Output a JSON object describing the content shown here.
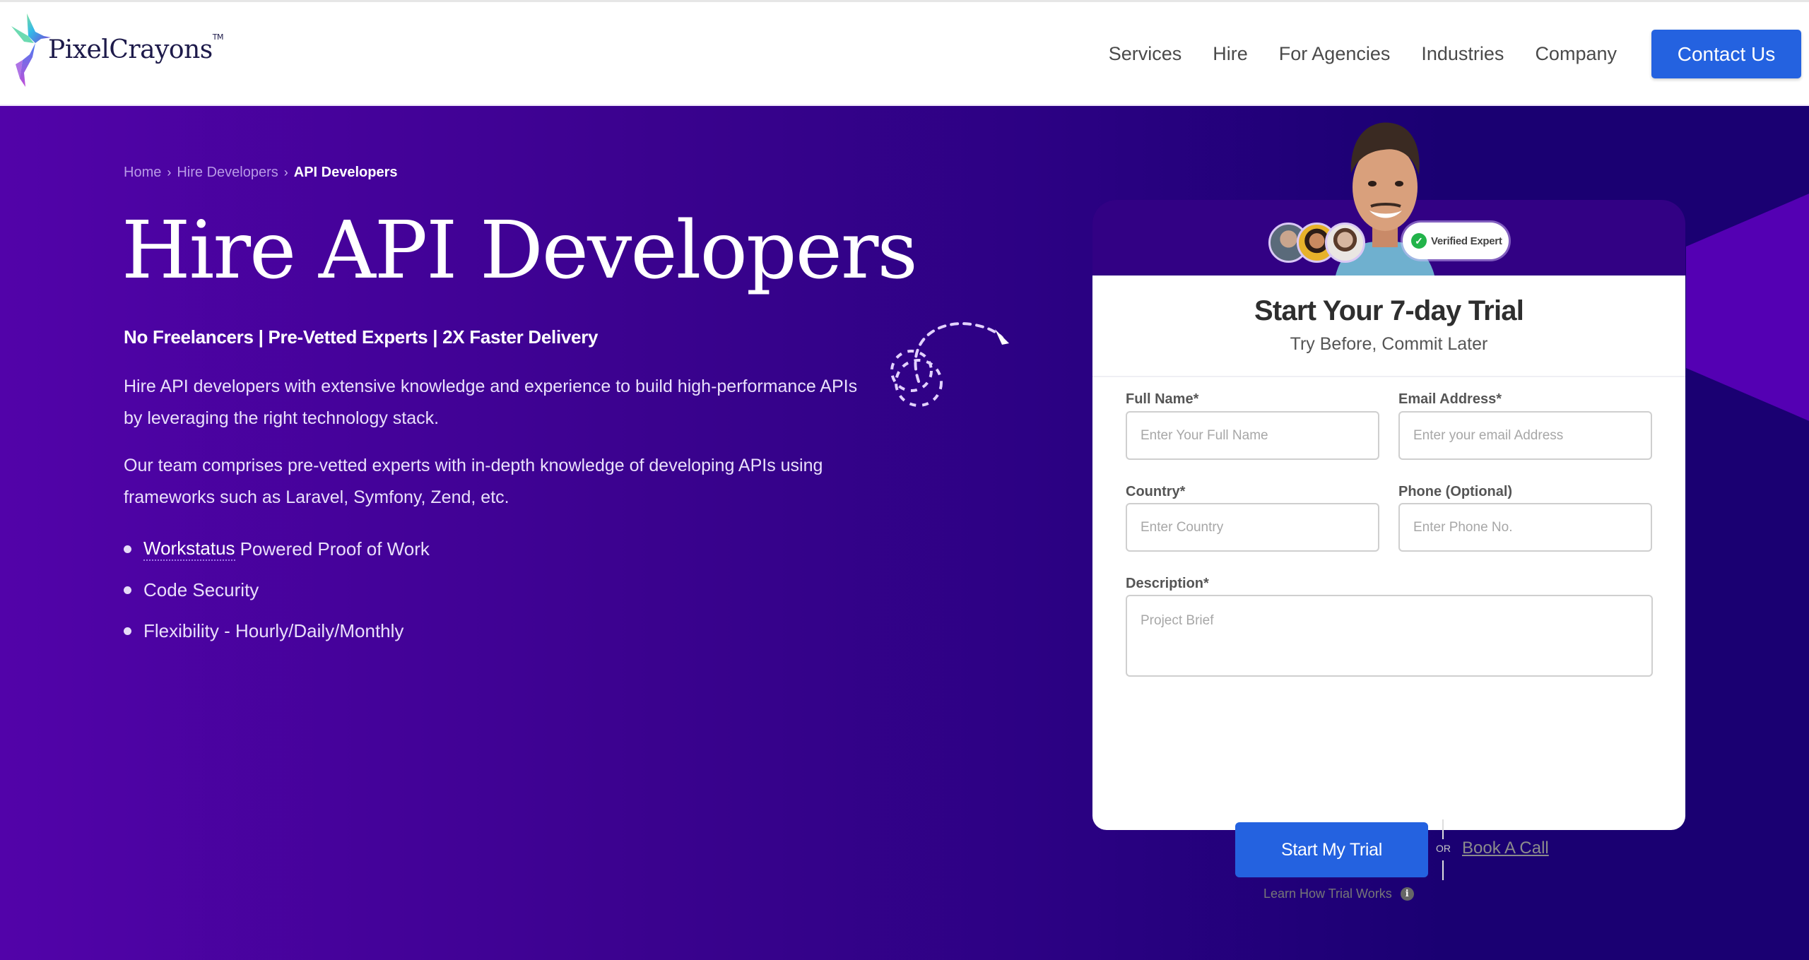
{
  "header": {
    "logo_text": "PixelCrayons",
    "logo_tm": "TM",
    "nav": [
      {
        "label": "Services"
      },
      {
        "label": "Hire"
      },
      {
        "label": "For Agencies"
      },
      {
        "label": "Industries"
      },
      {
        "label": "Company"
      }
    ],
    "contact_label": "Contact Us"
  },
  "hero": {
    "breadcrumb": [
      {
        "label": "Home"
      },
      {
        "label": "Hire Developers"
      },
      {
        "label": "API Developers"
      }
    ],
    "breadcrumb_separator": "›",
    "title": "Hire API Developers",
    "tagline": "No Freelancers | Pre-Vetted Experts | 2X Faster Delivery",
    "paragraph_1": "Hire API developers with extensive knowledge and experience to build high-performance APIs by leveraging the right technology stack.",
    "paragraph_2": "Our team comprises pre-vetted experts with in-depth knowledge of developing APIs using frameworks such as Laravel, Symfony, Zend, etc.",
    "bullets": [
      {
        "link": "Workstatus",
        "text": "Powered Proof of Work"
      },
      {
        "text": "Code Security"
      },
      {
        "text": "Flexibility - Hourly/Daily/Monthly"
      }
    ]
  },
  "form": {
    "badge_label": "Verified Expert",
    "badge_icon": "check-icon",
    "title": "Start Your 7-day Trial",
    "subtitle": "Try Before, Commit Later",
    "fields": {
      "full_name": {
        "label": "Full Name*",
        "placeholder": "Enter Your Full Name",
        "value": ""
      },
      "email": {
        "label": "Email Address*",
        "placeholder": "Enter your email Address",
        "value": ""
      },
      "country": {
        "label": "Country*",
        "placeholder": "Enter Country",
        "value": ""
      },
      "phone": {
        "label": "Phone (Optional)",
        "placeholder": "Enter Phone No.",
        "value": ""
      },
      "description": {
        "label": "Description*",
        "placeholder": "Project Brief",
        "value": ""
      }
    },
    "submit_label": "Start My Trial",
    "or_label": "OR",
    "book_call_label": "Book A Call",
    "learn_label": "Learn How Trial Works",
    "info_icon": "i"
  },
  "colors": {
    "primary_button": "#2462e0",
    "hero_gradient_start": "#5203a9",
    "hero_gradient_end": "#1a0072",
    "verified_green": "#22b34a"
  }
}
